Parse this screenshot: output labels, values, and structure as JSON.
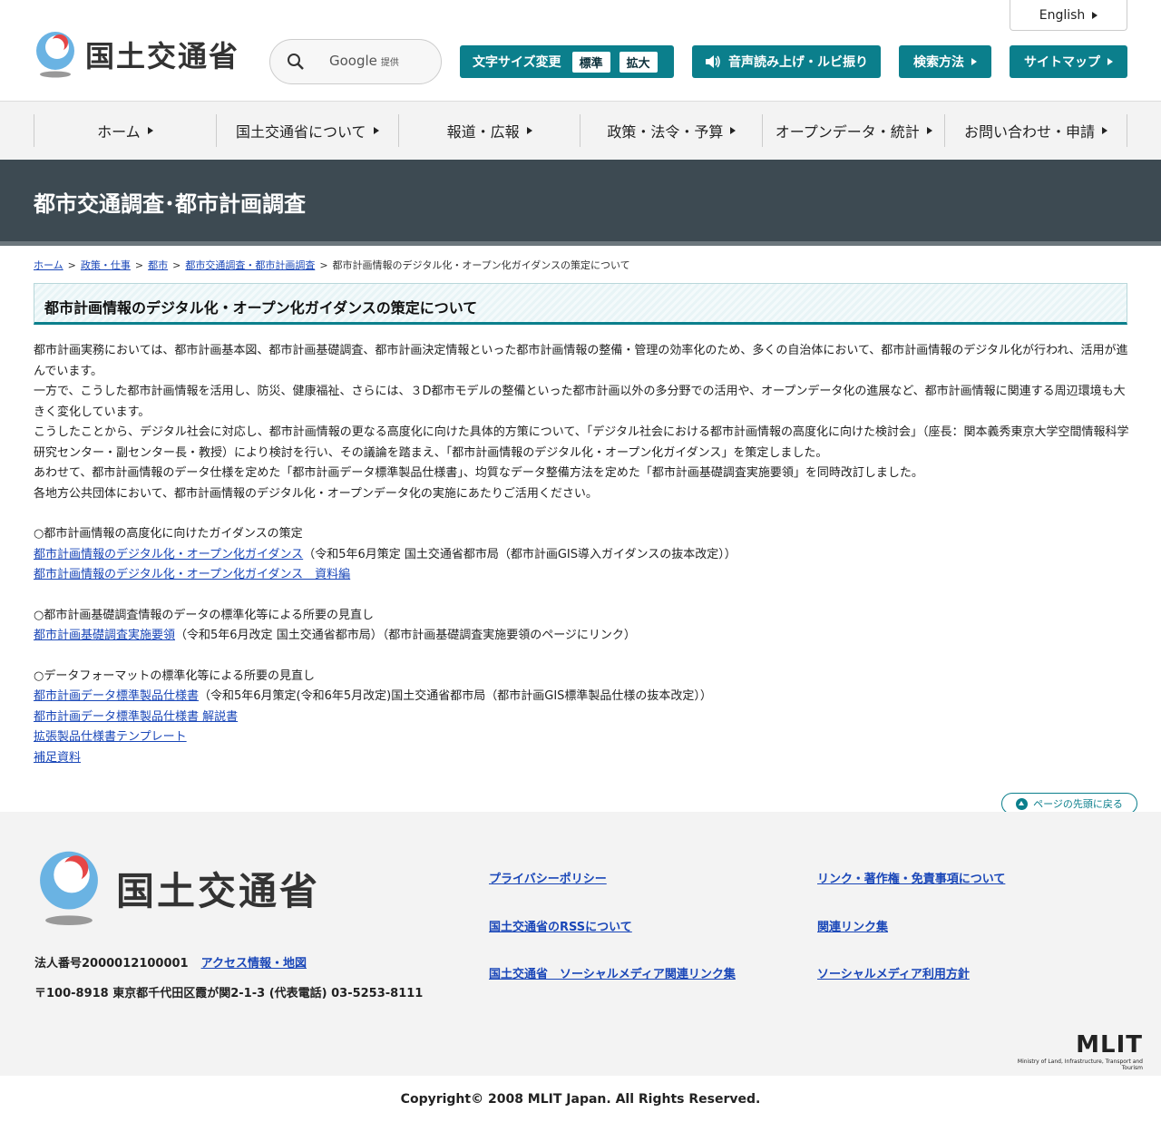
{
  "header": {
    "logo_text": "国土交通省",
    "search": {
      "google_label": "Google",
      "provided_label": "提供"
    },
    "font_size": {
      "label": "文字サイズ変更",
      "standard": "標準",
      "large": "拡大"
    },
    "voice_label": "音声読み上げ・ルビ振り",
    "howto_label": "検索方法",
    "sitemap_label": "サイトマップ",
    "english_label": "English"
  },
  "nav": {
    "items": [
      {
        "label": "ホーム"
      },
      {
        "label": "国土交通省について"
      },
      {
        "label": "報道・広報"
      },
      {
        "label": "政策・法令・予算"
      },
      {
        "label": "オープンデータ・統計"
      },
      {
        "label": "お問い合わせ・申請"
      }
    ]
  },
  "band_title": "都市交通調査･都市計画調査",
  "breadcrumb": {
    "items": [
      "ホーム",
      "政策・仕事",
      "都市",
      "都市交通調査・都市計画調査"
    ],
    "current": "都市計画情報のデジタル化・オープン化ガイダンスの策定について",
    "separator": ">"
  },
  "page_title": "都市計画情報のデジタル化・オープン化ガイダンスの策定について",
  "intro": [
    "都市計画実務においては、都市計画基本図、都市計画基礎調査、都市計画決定情報といった都市計画情報の整備・管理の効率化のため、多くの自治体において、都市計画情報のデジタル化が行われ、活用が進んでいます。",
    "一方で、こうした都市計画情報を活用し、防災、健康福祉、さらには、３D都市モデルの整備といった都市計画以外の多分野での活用や、オープンデータ化の進展など、都市計画情報に関連する周辺環境も大きく変化しています。",
    "こうしたことから、デジタル社会に対応し、都市計画情報の更なる高度化に向けた具体的方策について、「デジタル社会における都市計画情報の高度化に向けた検討会」（座長：関本義秀東京大学空間情報科学研究センター・副センター長・教授）により検討を行い、その議論を踏まえ、「都市計画情報のデジタル化・オープン化ガイダンス」を策定しました。",
    "あわせて、都市計画情報のデータ仕様を定めた「都市計画データ標準製品仕様書」、均質なデータ整備方法を定めた「都市計画基礎調査実施要領」を同時改訂しました。",
    "各地方公共団体において、都市計画情報のデジタル化・オープンデータ化の実施にあたりご活用ください。"
  ],
  "section1": {
    "heading": "○都市計画情報の高度化に向けたガイダンスの策定",
    "link1": "都市計画情報のデジタル化・オープン化ガイダンス",
    "link1_note": "（令和5年6月策定 国土交通省都市局（都市計画GIS導入ガイダンスの抜本改定））",
    "link2": "都市計画情報のデジタル化・オープン化ガイダンス　資料編"
  },
  "section2": {
    "heading": "○都市計画基礎調査情報のデータの標準化等による所要の見直し",
    "link1": "都市計画基礎調査実施要領",
    "link1_note": "（令和5年6月改定 国土交通省都市局）（都市計画基礎調査実施要領のページにリンク）"
  },
  "section3": {
    "heading": "○データフォーマットの標準化等による所要の見直し",
    "link1": "都市計画データ標準製品仕様書",
    "link1_note": "（令和5年6月策定(令和6年5月改定)国土交通省都市局（都市計画GIS標準製品仕様の抜本改定））",
    "link2": "都市計画データ標準製品仕様書 解説書",
    "link3": "拡張製品仕様書テンプレート",
    "link4": "補足資料"
  },
  "to_top_label": "ページの先頭に戻る",
  "footer": {
    "logo_text": "国土交通省",
    "corp_number": "法人番号2000012100001",
    "access_link": "アクセス情報・地図",
    "address": "〒100-8918 東京都千代田区霞が関2-1-3 (代表電話) 03-5253-8111",
    "links": [
      "プライバシーポリシー",
      "リンク・著作権・免責事項について",
      "国土交通省のRSSについて",
      "関連リンク集",
      "国土交通省　ソーシャルメディア関連リンク集",
      "ソーシャルメディア利用方針"
    ],
    "mlit_logo": "MLIT",
    "mlit_sub": "Ministry of Land, Infrastructure, Transport and Tourism",
    "copyright": "Copyright© 2008 MLIT Japan. All Rights Reserved."
  },
  "colors": {
    "accent": "#0b7f8c",
    "band": "#3d4a52",
    "link": "#1a47b8"
  }
}
